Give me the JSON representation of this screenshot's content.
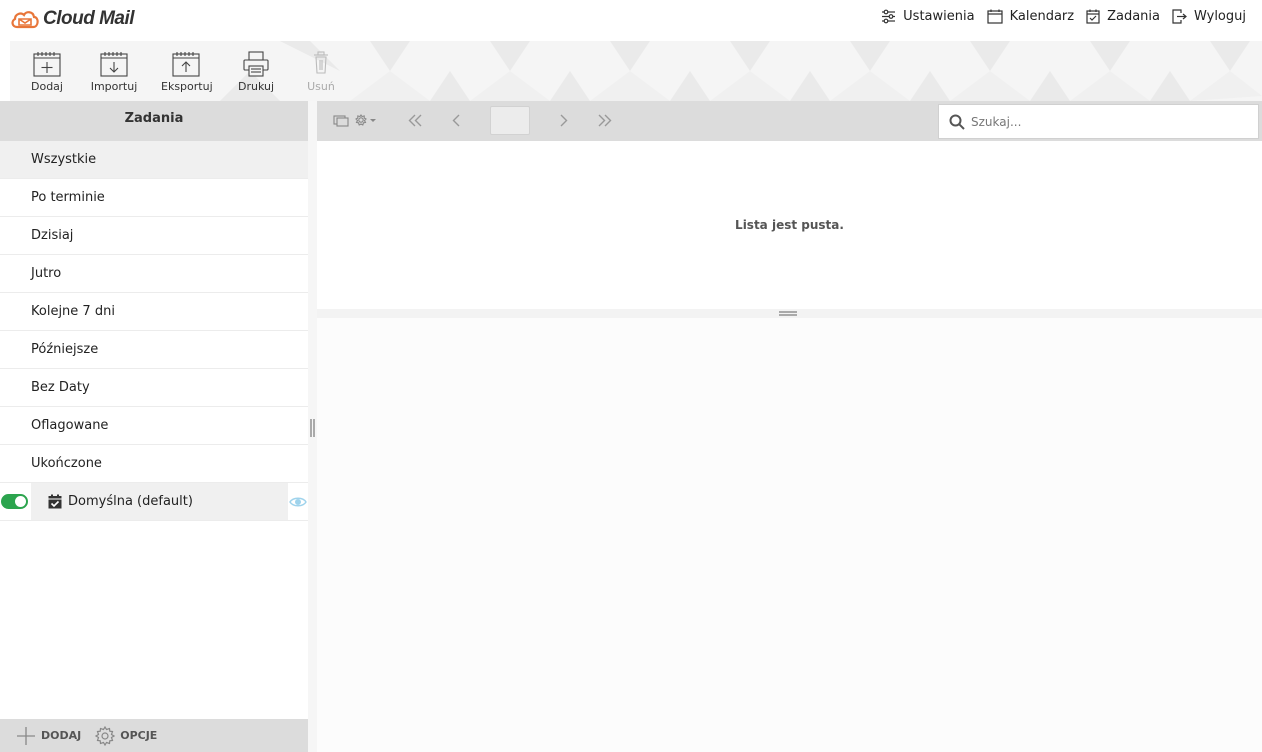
{
  "app": {
    "logo_text": "Cloud Mail",
    "accent": "#e8763a"
  },
  "topnav": {
    "settings": "Ustawienia",
    "calendar": "Kalendarz",
    "tasks": "Zadania",
    "logout": "Wyloguj"
  },
  "toolbar": {
    "add": "Dodaj",
    "import": "Importuj",
    "export": "Eksportuj",
    "print": "Drukuj",
    "delete": "Usuń"
  },
  "sidebar": {
    "title": "Zadania",
    "folders": [
      "Wszystkie",
      "Po terminie",
      "Dzisiaj",
      "Jutro",
      "Kolejne 7 dni",
      "Późniejsze",
      "Bez Daty",
      "Oflagowane",
      "Ukończone"
    ],
    "calendar": {
      "name": "Domyślna (default)",
      "enabled": true,
      "toggle_color": "#2ca44e"
    },
    "footer": {
      "add": "DODAJ",
      "options": "OPCJE"
    }
  },
  "list": {
    "search_placeholder": "Szukaj...",
    "page_value": "",
    "empty_message": "Lista jest pusta."
  }
}
